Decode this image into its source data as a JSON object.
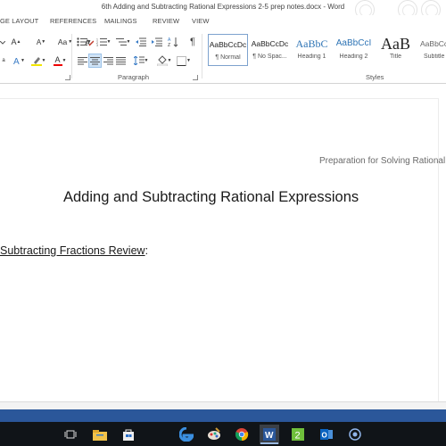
{
  "window": {
    "title": "6th Adding and Subtracting Rational Expressions 2-5 prep notes.docx - Word"
  },
  "ribbon_tabs": [
    {
      "label": "GE LAYOUT"
    },
    {
      "label": "REFERENCES"
    },
    {
      "label": "MAILINGS"
    },
    {
      "label": "REVIEW"
    },
    {
      "label": "VIEW"
    }
  ],
  "font_group": {
    "grow_label": "A",
    "shrink_label": "A",
    "case_label": "Aa",
    "font_color_label": "A"
  },
  "paragraph_group": {
    "label": "Paragraph",
    "pilcrow": "¶"
  },
  "styles_group": {
    "label": "Styles",
    "tiles": [
      {
        "sample": "AaBbCcDc",
        "name": "¶ Normal"
      },
      {
        "sample": "AaBbCcDc",
        "name": "¶ No Spac..."
      },
      {
        "sample": "AaBbC",
        "name": "Heading 1"
      },
      {
        "sample": "AaBbCcI",
        "name": "Heading 2"
      },
      {
        "sample": "AaB",
        "name": "Title"
      },
      {
        "sample": "AaBbCcD",
        "name": "Subtitle"
      }
    ]
  },
  "document": {
    "header_text": "Preparation for Solving Rational",
    "title": "Adding and Subtracting Rational Expressions",
    "section_heading": "Subtracting Fractions Review",
    "section_heading_colon": ":"
  },
  "taskbar": {
    "items": [
      {
        "icon": "task-view-icon"
      },
      {
        "icon": "file-explorer-icon"
      },
      {
        "icon": "store-icon"
      },
      {
        "icon": "edge-icon"
      },
      {
        "icon": "paint-icon"
      },
      {
        "icon": "chrome-icon"
      },
      {
        "icon": "word-icon",
        "label": "W"
      },
      {
        "icon": "app-2-icon",
        "label": "2"
      },
      {
        "icon": "outlook-icon",
        "label": "O"
      },
      {
        "icon": "cortana-circle-icon"
      }
    ]
  },
  "colors": {
    "word_blue": "#2b579a",
    "taskbar": "#101418",
    "ribbon_selected": "#cfe3f6",
    "heading_blue": "#2e74b5"
  }
}
